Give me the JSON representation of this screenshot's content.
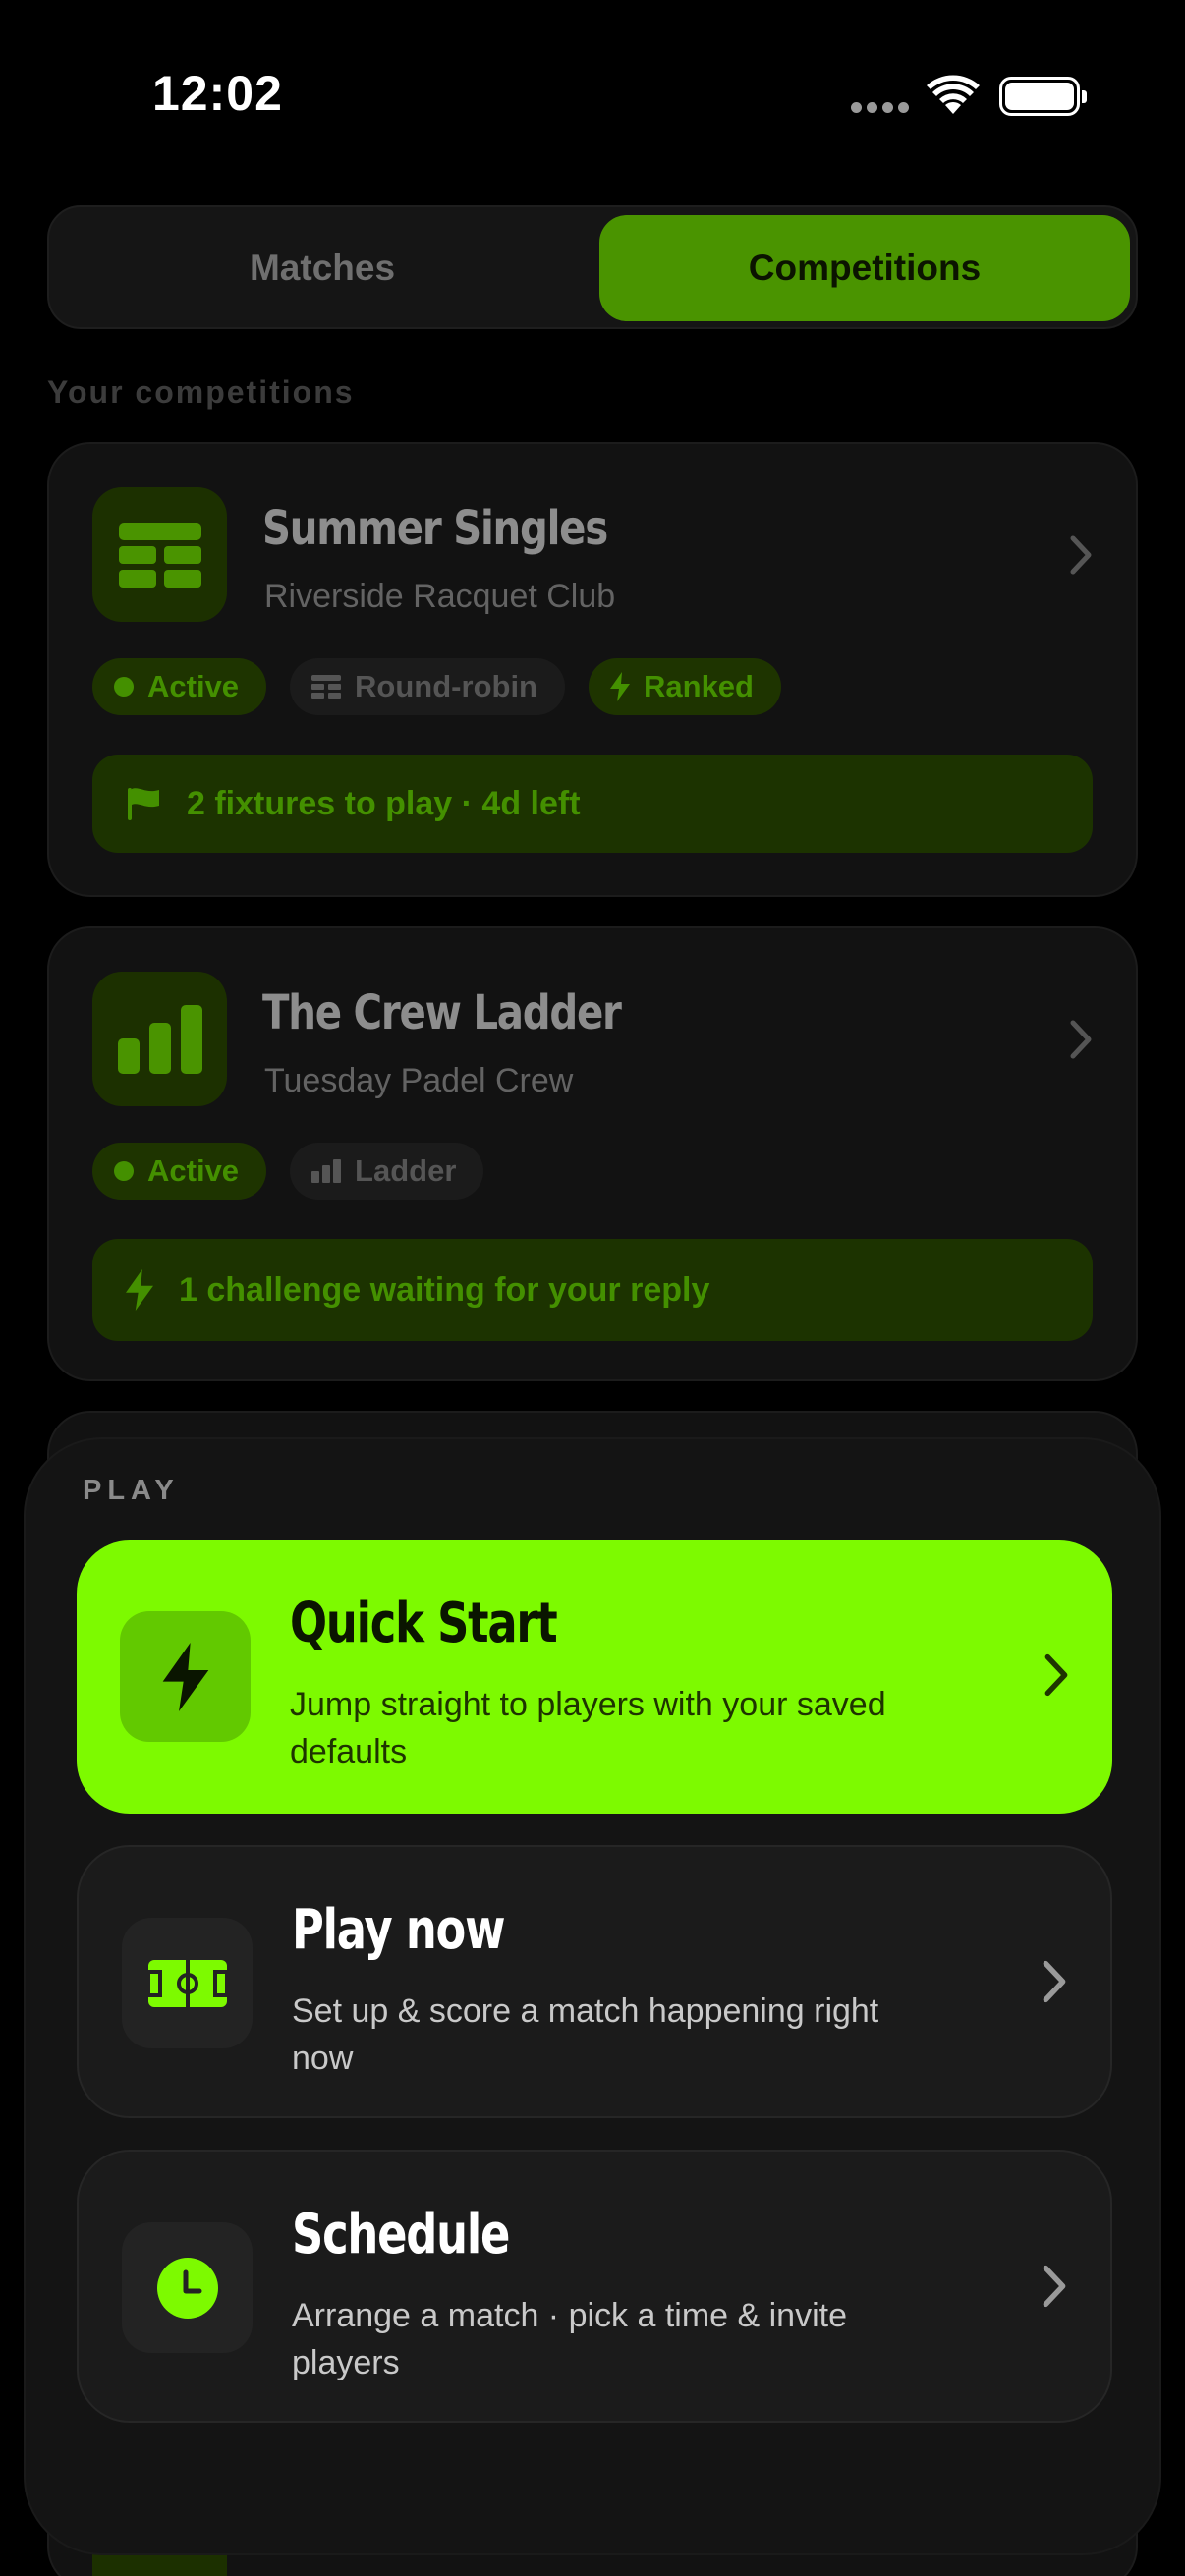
{
  "status_bar": {
    "time": "12:02"
  },
  "tabs": {
    "matches": "Matches",
    "competitions": "Competitions"
  },
  "section_label": "Your competitions",
  "competitions": [
    {
      "name": "Summer Singles",
      "club": "Riverside Racquet Club",
      "icon": "grid-icon",
      "chips": [
        "Active",
        "Round-robin",
        "Ranked"
      ],
      "banner": "2 fixtures to play · 4d left",
      "banner_icon": "flag-icon"
    },
    {
      "name": "The Crew Ladder",
      "club": "Tuesday Padel Crew",
      "icon": "bar-chart-icon",
      "chips": [
        "Active",
        "Ladder"
      ],
      "banner": "1 challenge waiting for your reply",
      "banner_icon": "bolt-icon"
    }
  ],
  "play_sheet": {
    "label": "PLAY",
    "options": [
      {
        "title": "Quick Start",
        "desc": "Jump straight to players with your saved defaults",
        "icon": "bolt-icon"
      },
      {
        "title": "Play now",
        "desc": "Set up & score a match happening right now",
        "icon": "court-icon"
      },
      {
        "title": "Schedule",
        "desc": "Arrange a match · pick a time & invite players",
        "icon": "clock-icon"
      }
    ]
  },
  "colors": {
    "accent": "#7dfa00",
    "accent_dim": "#4a9400",
    "background": "#000000",
    "card": "#121212"
  }
}
